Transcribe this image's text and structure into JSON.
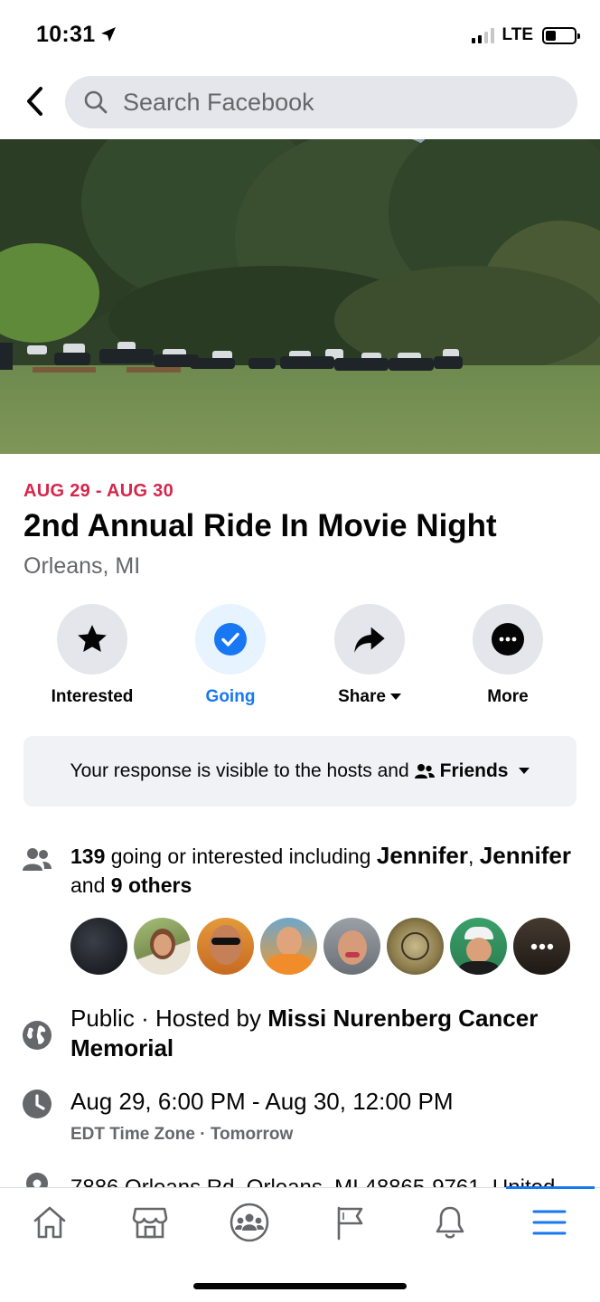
{
  "status_bar": {
    "time": "10:31",
    "network": "LTE"
  },
  "search": {
    "placeholder": "Search Facebook"
  },
  "event": {
    "date_range": "AUG 29 - AUG 30",
    "title": "2nd Annual Ride In Movie Night",
    "location": "Orleans, MI"
  },
  "actions": [
    {
      "label": "Interested"
    },
    {
      "label": "Going"
    },
    {
      "label": "Share"
    },
    {
      "label": "More"
    }
  ],
  "visibility": {
    "text": "Your response is visible to the hosts and",
    "audience": "Friends"
  },
  "attendance": {
    "count": "139",
    "text_1": "going or interested including",
    "name_1": "Jennifer",
    "name_2": "Jennifer",
    "text_2": "and",
    "others": "9 others"
  },
  "host": {
    "privacy": "Public",
    "hosted_by_text": "· Hosted by",
    "host_name": "Missi Nurenberg Cancer Memorial"
  },
  "time_info": {
    "range": "Aug 29, 6:00 PM - Aug 30, 12:00 PM",
    "timezone": "EDT Time Zone",
    "relative": "Tomorrow"
  },
  "address": {
    "text": "7886 Orleans Rd, Orleans, MI 48865-9761, United"
  },
  "colors": {
    "accent": "#1877f2",
    "date_red": "#d6264c",
    "secondary_text": "#65676b",
    "surface": "#e4e6eb"
  },
  "icons": [
    "location-arrow-icon",
    "back-arrow-icon",
    "search-icon",
    "star-icon",
    "check-circle-icon",
    "share-arrow-icon",
    "more-dots-icon",
    "friends-icon",
    "people-icon",
    "globe-icon",
    "clock-icon",
    "pin-icon",
    "home-icon",
    "marketplace-icon",
    "groups-icon",
    "pages-flag-icon",
    "bell-icon",
    "menu-icon"
  ]
}
